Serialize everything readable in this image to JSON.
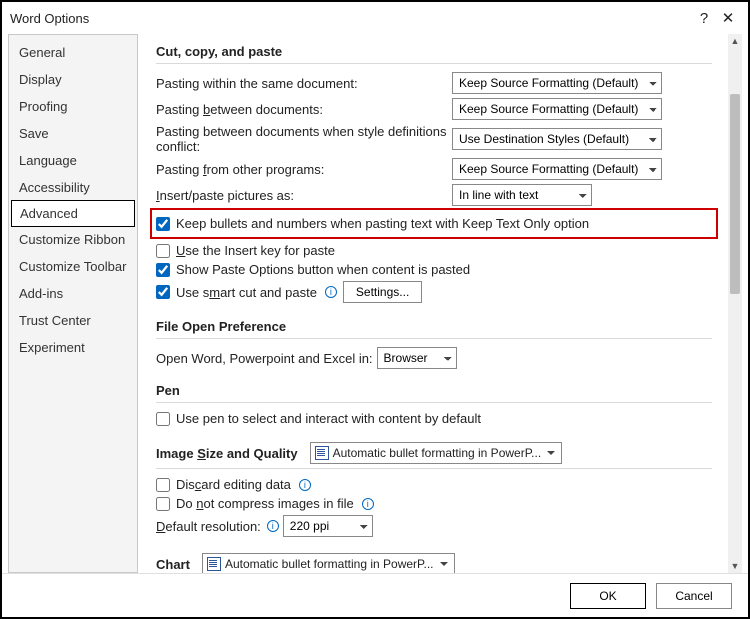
{
  "title": "Word Options",
  "sidebar": {
    "items": [
      {
        "label": "General"
      },
      {
        "label": "Display"
      },
      {
        "label": "Proofing"
      },
      {
        "label": "Save"
      },
      {
        "label": "Language"
      },
      {
        "label": "Accessibility"
      },
      {
        "label": "Advanced",
        "selected": true
      },
      {
        "label": "Customize Ribbon"
      },
      {
        "label": "Customize Toolbar"
      },
      {
        "label": "Add-ins"
      },
      {
        "label": "Trust Center"
      },
      {
        "label": "Experiment"
      }
    ]
  },
  "cut_copy_paste": {
    "header": "Cut, copy, and paste",
    "rows": {
      "same_doc_label": "Pasting within the same document:",
      "same_doc_value": "Keep Source Formatting (Default)",
      "between_label_pre": "Pasting ",
      "between_label_u": "b",
      "between_label_post": "etween documents:",
      "between_value": "Keep Source Formatting (Default)",
      "between_conflict_label": "Pasting between documents when style definitions conflict:",
      "between_conflict_value": "Use Destination Styles (Default)",
      "other_prog_label_pre": "Pasting ",
      "other_prog_label_u": "f",
      "other_prog_label_post": "rom other programs:",
      "other_prog_value": "Keep Source Formatting (Default)",
      "insert_pic_label_pre": "",
      "insert_pic_label_u": "I",
      "insert_pic_label_post": "nsert/paste pictures as:",
      "insert_pic_value": "In line with text"
    },
    "checks": {
      "keep_bullets": "Keep bullets and numbers when pasting text with Keep Text Only option",
      "insert_key_pre": "",
      "insert_key_u": "U",
      "insert_key_post": "se the Insert key for paste",
      "show_paste": "Show Paste Options button when content is pasted",
      "smart_cut_pre": "Use s",
      "smart_cut_u": "m",
      "smart_cut_post": "art cut and paste",
      "settings_btn_pre": "Settin",
      "settings_btn_u": "g",
      "settings_btn_post": "s..."
    }
  },
  "file_open": {
    "header": "File Open Preference",
    "label": "Open Word, Powerpoint and Excel in:",
    "value": "Browser"
  },
  "pen": {
    "header": "Pen",
    "check": "Use pen to select and interact with content by default"
  },
  "image_sq": {
    "header_pre": "Image ",
    "header_u": "S",
    "header_post": "ize and Quality",
    "doc": "Automatic bullet formatting in PowerP...",
    "discard_pre": "Dis",
    "discard_u": "c",
    "discard_post": "ard editing data",
    "nocompress_pre": "Do ",
    "nocompress_u": "n",
    "nocompress_post": "ot compress images in file",
    "defres_pre": "",
    "defres_u": "D",
    "defres_post": "efault resolution:",
    "defres_value": "220 ppi"
  },
  "chart": {
    "header": "Chart",
    "doc": "Automatic bullet formatting in PowerP..."
  },
  "footer": {
    "ok": "OK",
    "cancel": "Cancel"
  }
}
